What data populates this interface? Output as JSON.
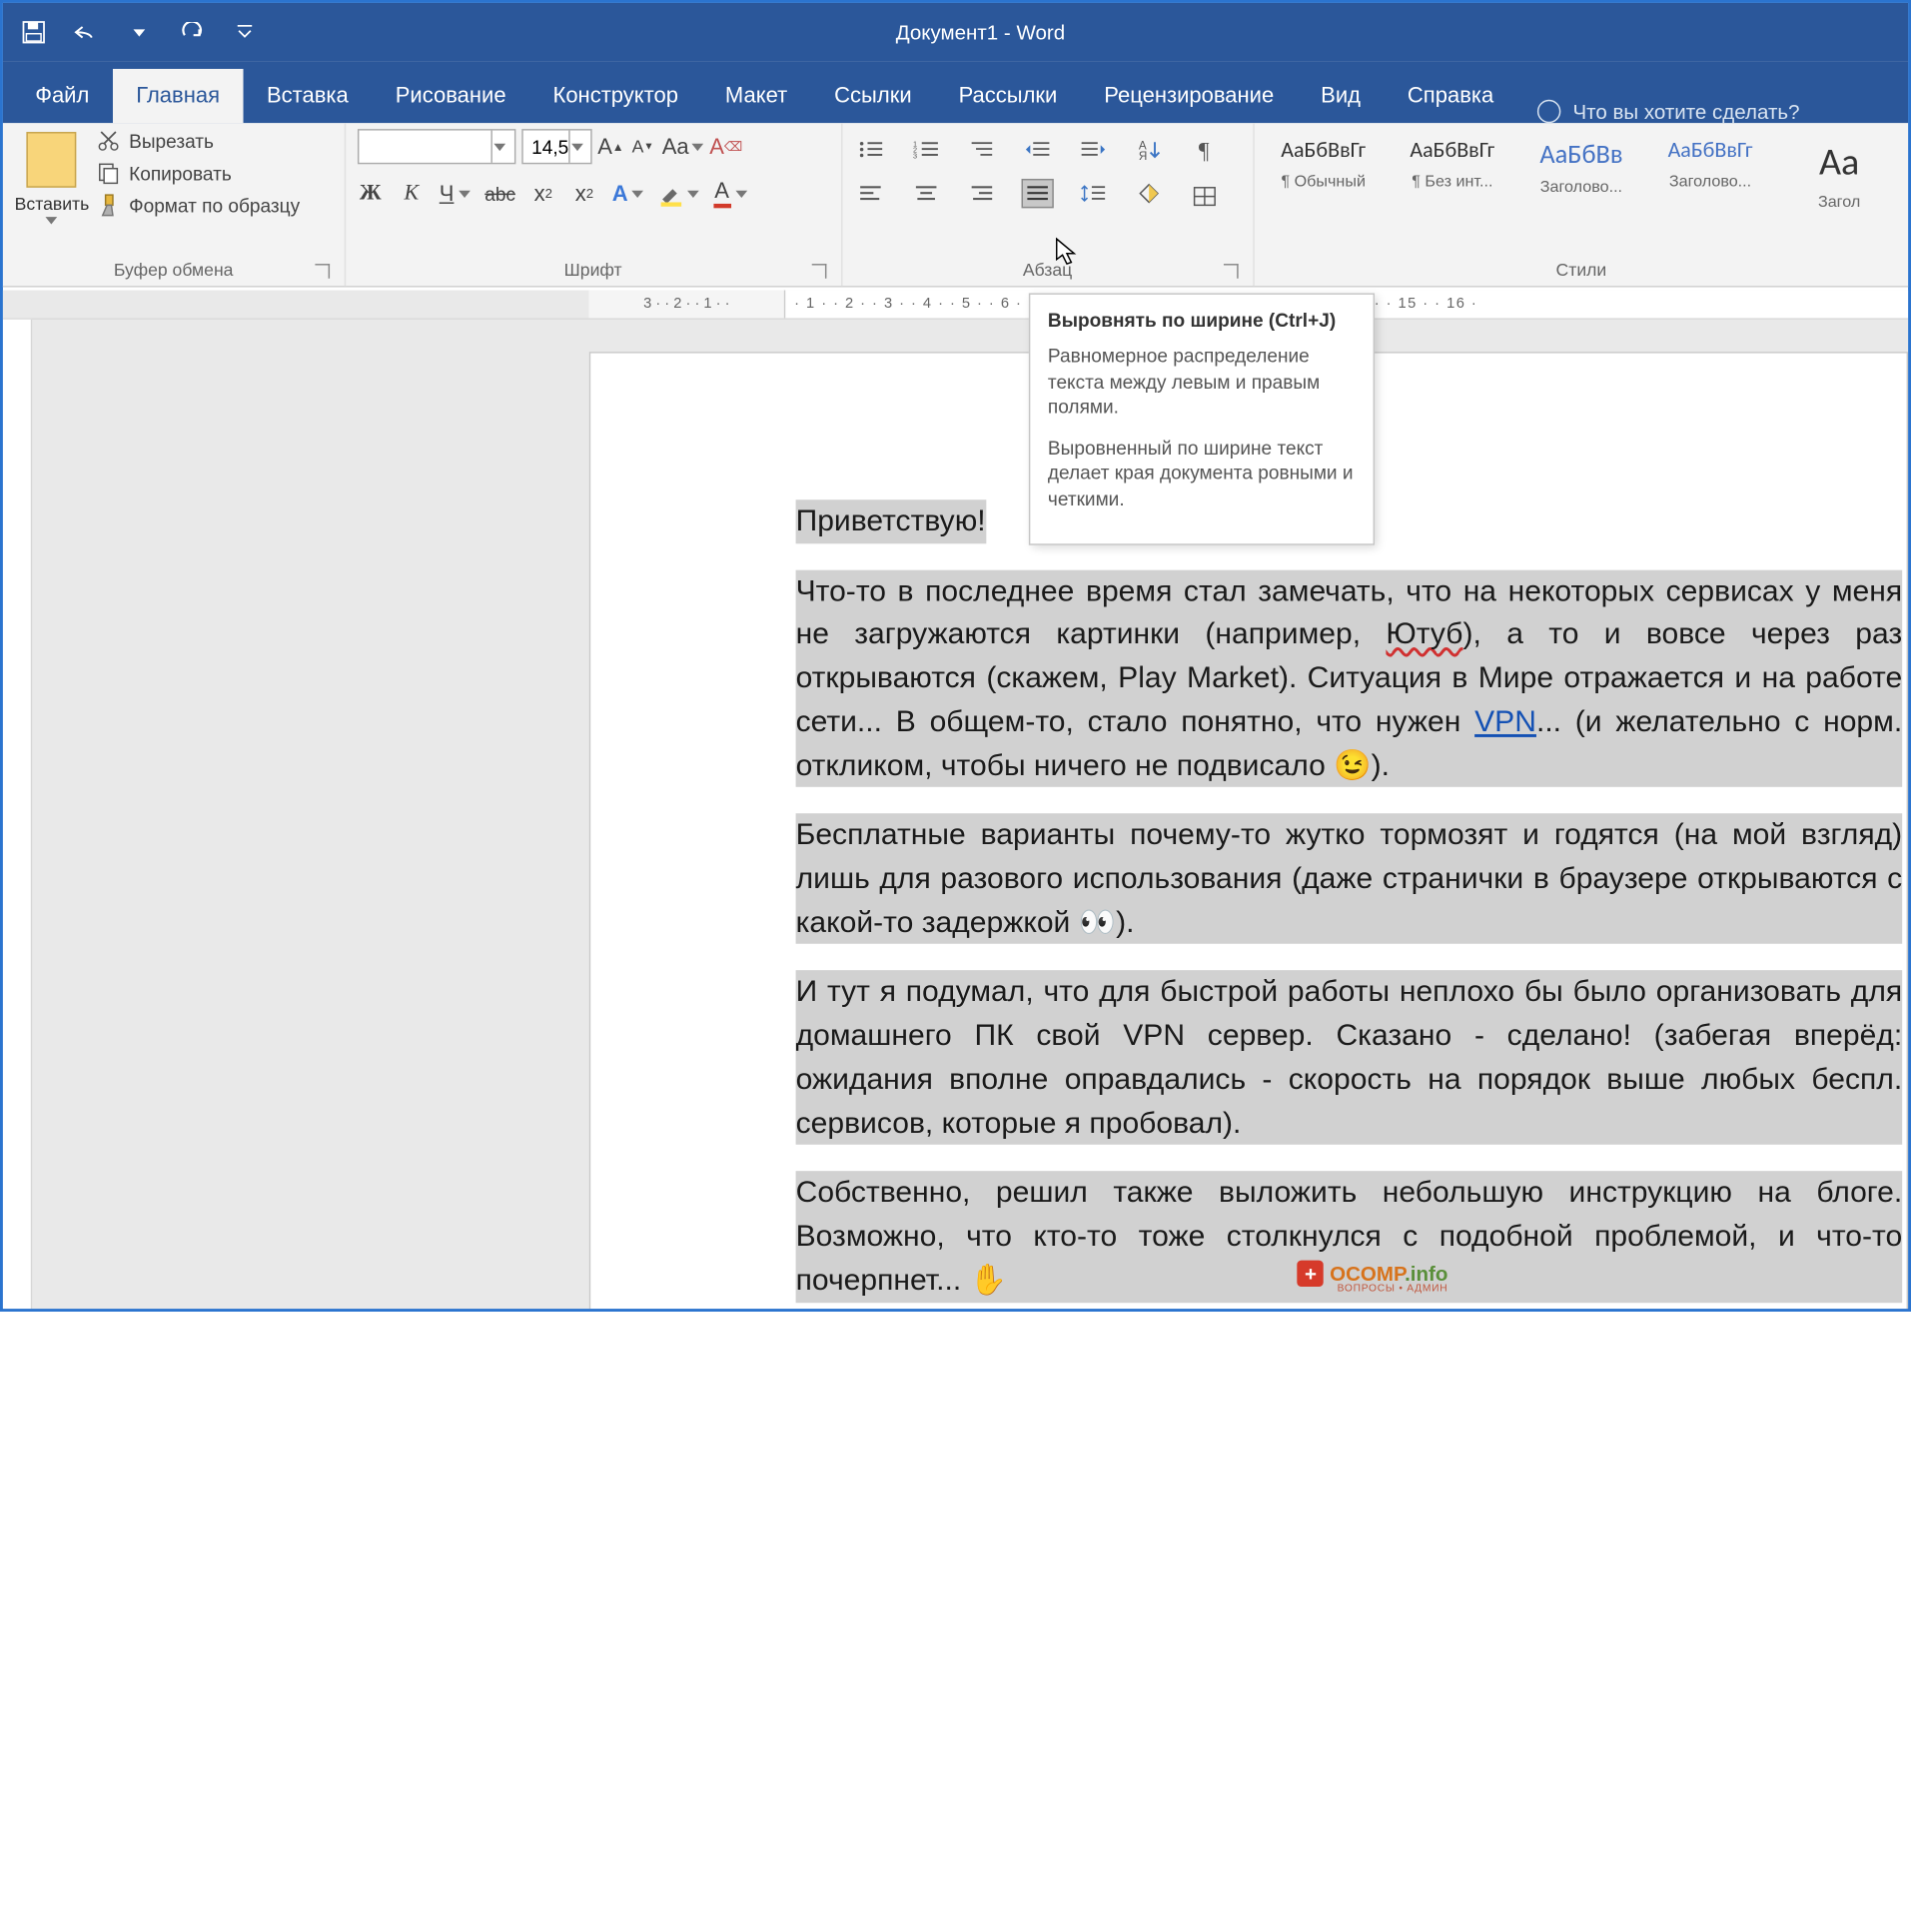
{
  "title": "Документ1  -  Word",
  "tabs": [
    "Файл",
    "Главная",
    "Вставка",
    "Рисование",
    "Конструктор",
    "Макет",
    "Ссылки",
    "Рассылки",
    "Рецензирование",
    "Вид",
    "Справка"
  ],
  "active_tab_index": 1,
  "tellme": "Что вы хотите сделать?",
  "clipboard": {
    "paste": "Вставить",
    "cut": "Вырезать",
    "copy": "Копировать",
    "format_painter": "Формат по образцу",
    "group": "Буфер обмена"
  },
  "font": {
    "name": "",
    "size": "14,5",
    "group": "Шрифт",
    "bold": "Ж",
    "italic": "К",
    "underline": "Ч",
    "strike": "abc",
    "sub": "x",
    "sup": "x",
    "grow": "A",
    "shrink": "A",
    "case": "Aa",
    "clear": "A",
    "texteffects": "A",
    "highlight": "",
    "color": "A"
  },
  "paragraph": {
    "group": "Абзац"
  },
  "styles": {
    "preview": "АаБбВвГг",
    "preview_short": "АаБбВв",
    "preview_big": "Аа",
    "names": [
      "¶ Обычный",
      "¶ Без инт...",
      "Заголово...",
      "Заголово...",
      "Загол"
    ],
    "group": "Стили"
  },
  "tooltip": {
    "title": "Выровнять по ширине (Ctrl+J)",
    "p1": "Равномерное распределение текста между левым и правым полями.",
    "p2": "Выровненный по ширине текст делает края документа ровными и четкими."
  },
  "document": {
    "greet": "Приветствую!",
    "p1a": "Что-то в последнее время стал замечать, что на некоторых сервисах у меня не загружаются картинки (например, ",
    "p1_err": "Ютуб",
    "p1b": "), а то и вовсе через раз открываются (скажем, Play Market). Ситуация в Мире отражается и на работе сети... В общем-то, стало понятно, что нужен ",
    "p1_link": "VPN",
    "p1c": "... (и желательно с норм. откликом, чтобы ничего не подвисало 😉).",
    "p2": "Бесплатные варианты почему-то жутко тормозят и годятся (на мой взгляд) лишь для разового использования (даже странички в браузере открываются с какой-то задержкой 👀).",
    "p3": "И тут я подумал, что для быстрой работы неплохо бы было организовать для домашнего ПК свой VPN сервер. Сказано - сделано! (забегая вперёд: ожидания вполне оправдались - скорость на порядок выше любых беспл. сервисов, которые я пробовал).",
    "p4": "Собственно, решил также выложить небольшую инструкцию на блоге. Возможно, что кто-то тоже столкнулся с подобной проблемой, и что-то почерпнет...  ✋"
  },
  "watermark": {
    "main": "OCOMP",
    "suf": ".info",
    "sub": "ВОПРОСЫ • АДМИН"
  }
}
